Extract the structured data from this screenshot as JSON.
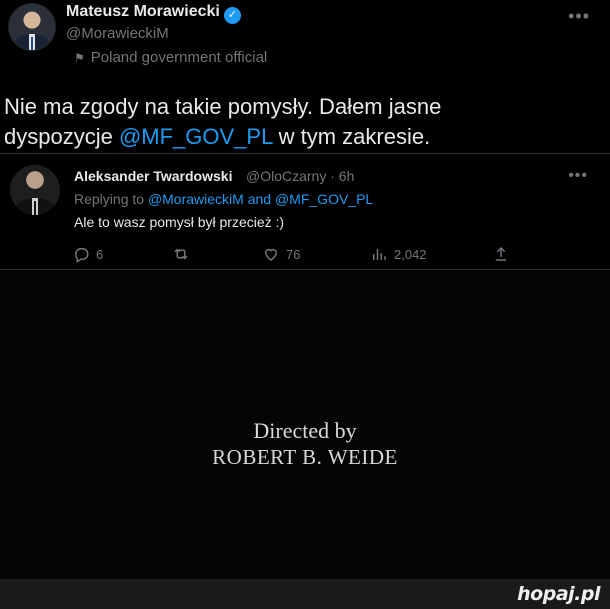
{
  "main_tweet": {
    "author_name": "Mateusz Morawiecki",
    "handle": "@MorawieckiM",
    "gov_label": "Poland government official",
    "text_part1": "Nie ma zgody na takie pomysły. Dałem jasne",
    "text_part2": "dyspozycje ",
    "mention": "@MF_GOV_PL",
    "text_part3": " w tym zakresie."
  },
  "reply": {
    "author_name": "Aleksander Twardowski",
    "meta": "@OloCzarny · 6h",
    "replying_prefix": "Replying to ",
    "replying_handles": "@MorawieckiM and @MF_GOV_PL",
    "body": "Ale to wasz pomysł był przecież :)",
    "stats": {
      "replies": "6",
      "likes": "76",
      "views": "2,042"
    }
  },
  "movie_credits": {
    "line1": "Directed by",
    "line2": "ROBERT B. WEIDE"
  },
  "watermark": "hopaj.pl",
  "colors": {
    "accent": "#1d9bf0",
    "muted": "#71767b",
    "background": "#000000"
  },
  "icons": [
    "verified-icon",
    "flag-icon",
    "more-icon",
    "reply-icon",
    "retweet-icon",
    "like-icon",
    "views-icon",
    "share-icon"
  ]
}
